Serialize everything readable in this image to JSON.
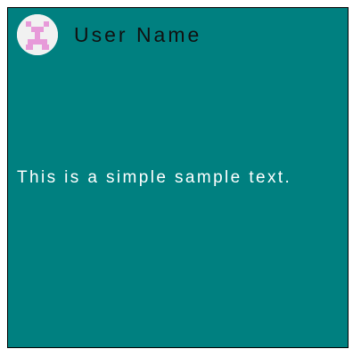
{
  "colors": {
    "background": "#008080",
    "border": "#000000",
    "name_text": "#111111",
    "body_text": "#ffffff",
    "avatar_background": "#f1f1f1",
    "avatar_pattern": "#e79ad9"
  },
  "profile": {
    "avatar_icon": "identicon-avatar-icon",
    "user_name": "User Name"
  },
  "content": {
    "text": "This is a simple sample text."
  }
}
